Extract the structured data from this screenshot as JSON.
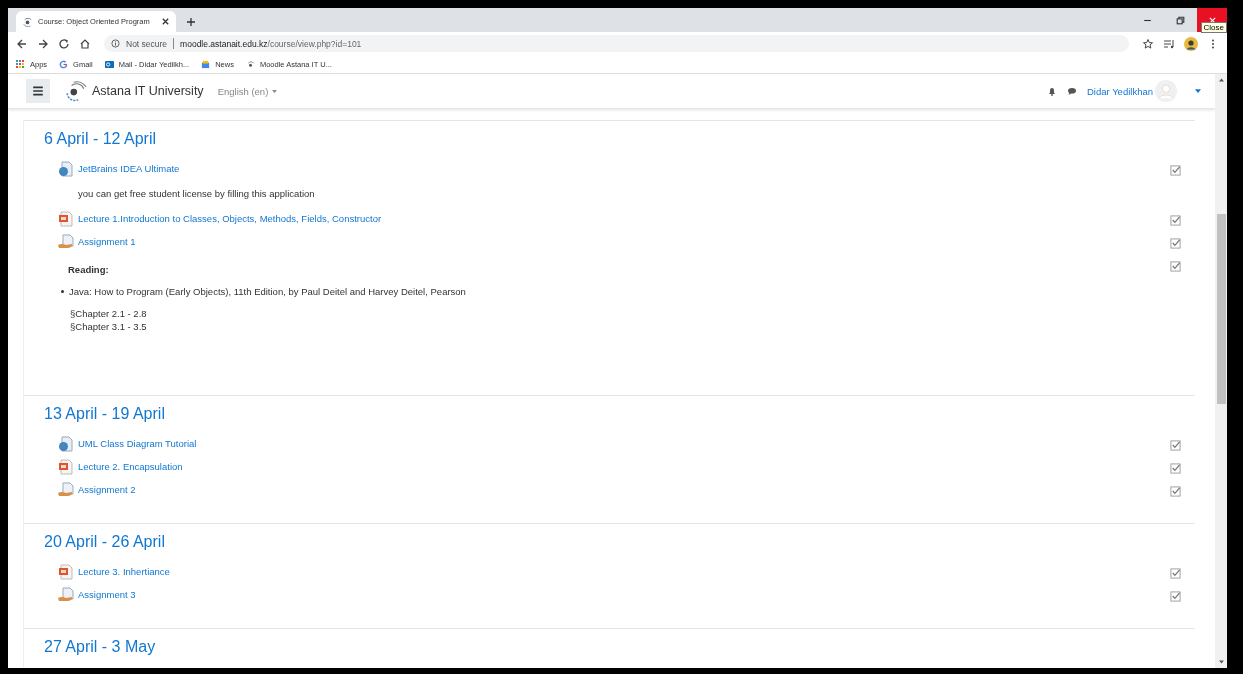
{
  "browser": {
    "tab_title": "Course: Object Oriented Program",
    "tooltip": "Close",
    "security": "Not secure",
    "url_host": "moodle.astanait.edu.kz",
    "url_path": "/course/view.php?id=101",
    "bookmarks": [
      {
        "label": "Apps",
        "kind": "apps"
      },
      {
        "label": "Gmail",
        "kind": "google"
      },
      {
        "label": "Mail - Didar Yedilkh...",
        "kind": "mail"
      },
      {
        "label": "News",
        "kind": "news"
      },
      {
        "label": "Moodle Astana IT U...",
        "kind": "moodle"
      }
    ]
  },
  "navbar": {
    "site_name": "Astana IT University",
    "language": "English (en)",
    "user_name": "Didar Yedilkhan"
  },
  "sections": [
    {
      "title": "6 April - 12 April",
      "items": [
        {
          "kind": "url",
          "name": "JetBrains IDEA Ultimate",
          "checked": true
        },
        {
          "kind": "text",
          "text": "you can get free student license by filling this application"
        },
        {
          "kind": "pdf",
          "name": "Lecture 1.Introduction to Classes, Objects, Methods, Fields, Constructor",
          "checked": true
        },
        {
          "kind": "assign",
          "name": "Assignment 1",
          "checked": true
        },
        {
          "kind": "label",
          "heading": "Reading:",
          "bullets": [
            "Java: How to Program (Early Objects), 11th Edition, by Paul Deitel and Harvey Deitel, Pearson"
          ],
          "lines": [
            "§Chapter 2.1 - 2.8",
            "§Chapter 3.1 - 3.5"
          ],
          "checked": true
        }
      ]
    },
    {
      "title": "13 April - 19 April",
      "items": [
        {
          "kind": "url",
          "name": "UML Class Diagram Tutorial",
          "checked": true
        },
        {
          "kind": "pdf",
          "name": "Lecture 2. Encapsulation",
          "checked": true
        },
        {
          "kind": "assign",
          "name": "Assignment 2",
          "checked": true
        }
      ]
    },
    {
      "title": "20 April - 26 April",
      "items": [
        {
          "kind": "pdf",
          "name": "Lecture 3. Inhertiance",
          "checked": true
        },
        {
          "kind": "assign",
          "name": "Assignment 3",
          "checked": true
        }
      ]
    },
    {
      "title": "27 April - 3 May"
    }
  ]
}
